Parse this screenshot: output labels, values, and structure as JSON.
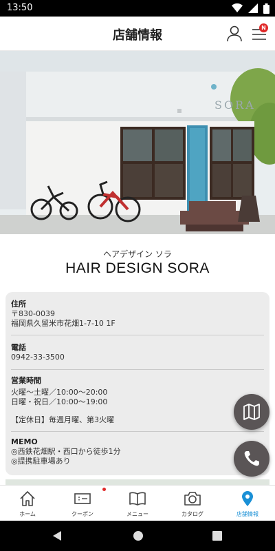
{
  "status_bar": {
    "time": "13:50",
    "icons": [
      "wifi-icon",
      "signal-icon",
      "battery-icon"
    ]
  },
  "header": {
    "title": "店舗情報",
    "account_icon": "account-icon",
    "menu_icon": "hamburger-menu-icon",
    "menu_badge": "N"
  },
  "hero": {
    "sign_text": "SORA"
  },
  "store": {
    "name_kana": "ヘアデザイン ソラ",
    "name": "HAIR DESIGN SORA"
  },
  "info": {
    "address": {
      "label": "住所",
      "postal": "〒830-0039",
      "line": "福岡県久留米市花畑1-7-10 1F"
    },
    "phone": {
      "label": "電話",
      "number": "0942-33-3500"
    },
    "hours": {
      "label": "営業時間",
      "weekday": "火曜～土曜／10:00～20:00",
      "weekend": "日曜・祝日／10:00～19:00",
      "closed": "【定休日】毎週月曜、第3火曜"
    },
    "memo": {
      "label": "MEMO",
      "line1": "◎西鉄花畑駅・西口から徒歩1分",
      "line2": "◎提携駐車場あり"
    }
  },
  "fabs": {
    "map_icon": "map-icon",
    "phone_icon": "phone-icon"
  },
  "tabs": [
    {
      "label": "ホーム",
      "icon": "home-icon"
    },
    {
      "label": "クーポン",
      "icon": "coupon-icon"
    },
    {
      "label": "メニュー",
      "icon": "menu-book-icon"
    },
    {
      "label": "カタログ",
      "icon": "camera-icon"
    },
    {
      "label": "店舗情報",
      "icon": "location-pin-icon"
    }
  ],
  "colors": {
    "active_tab": "#1a90d6",
    "badge": "#e02828",
    "fab": "#5a5556",
    "card": "#ececec"
  }
}
